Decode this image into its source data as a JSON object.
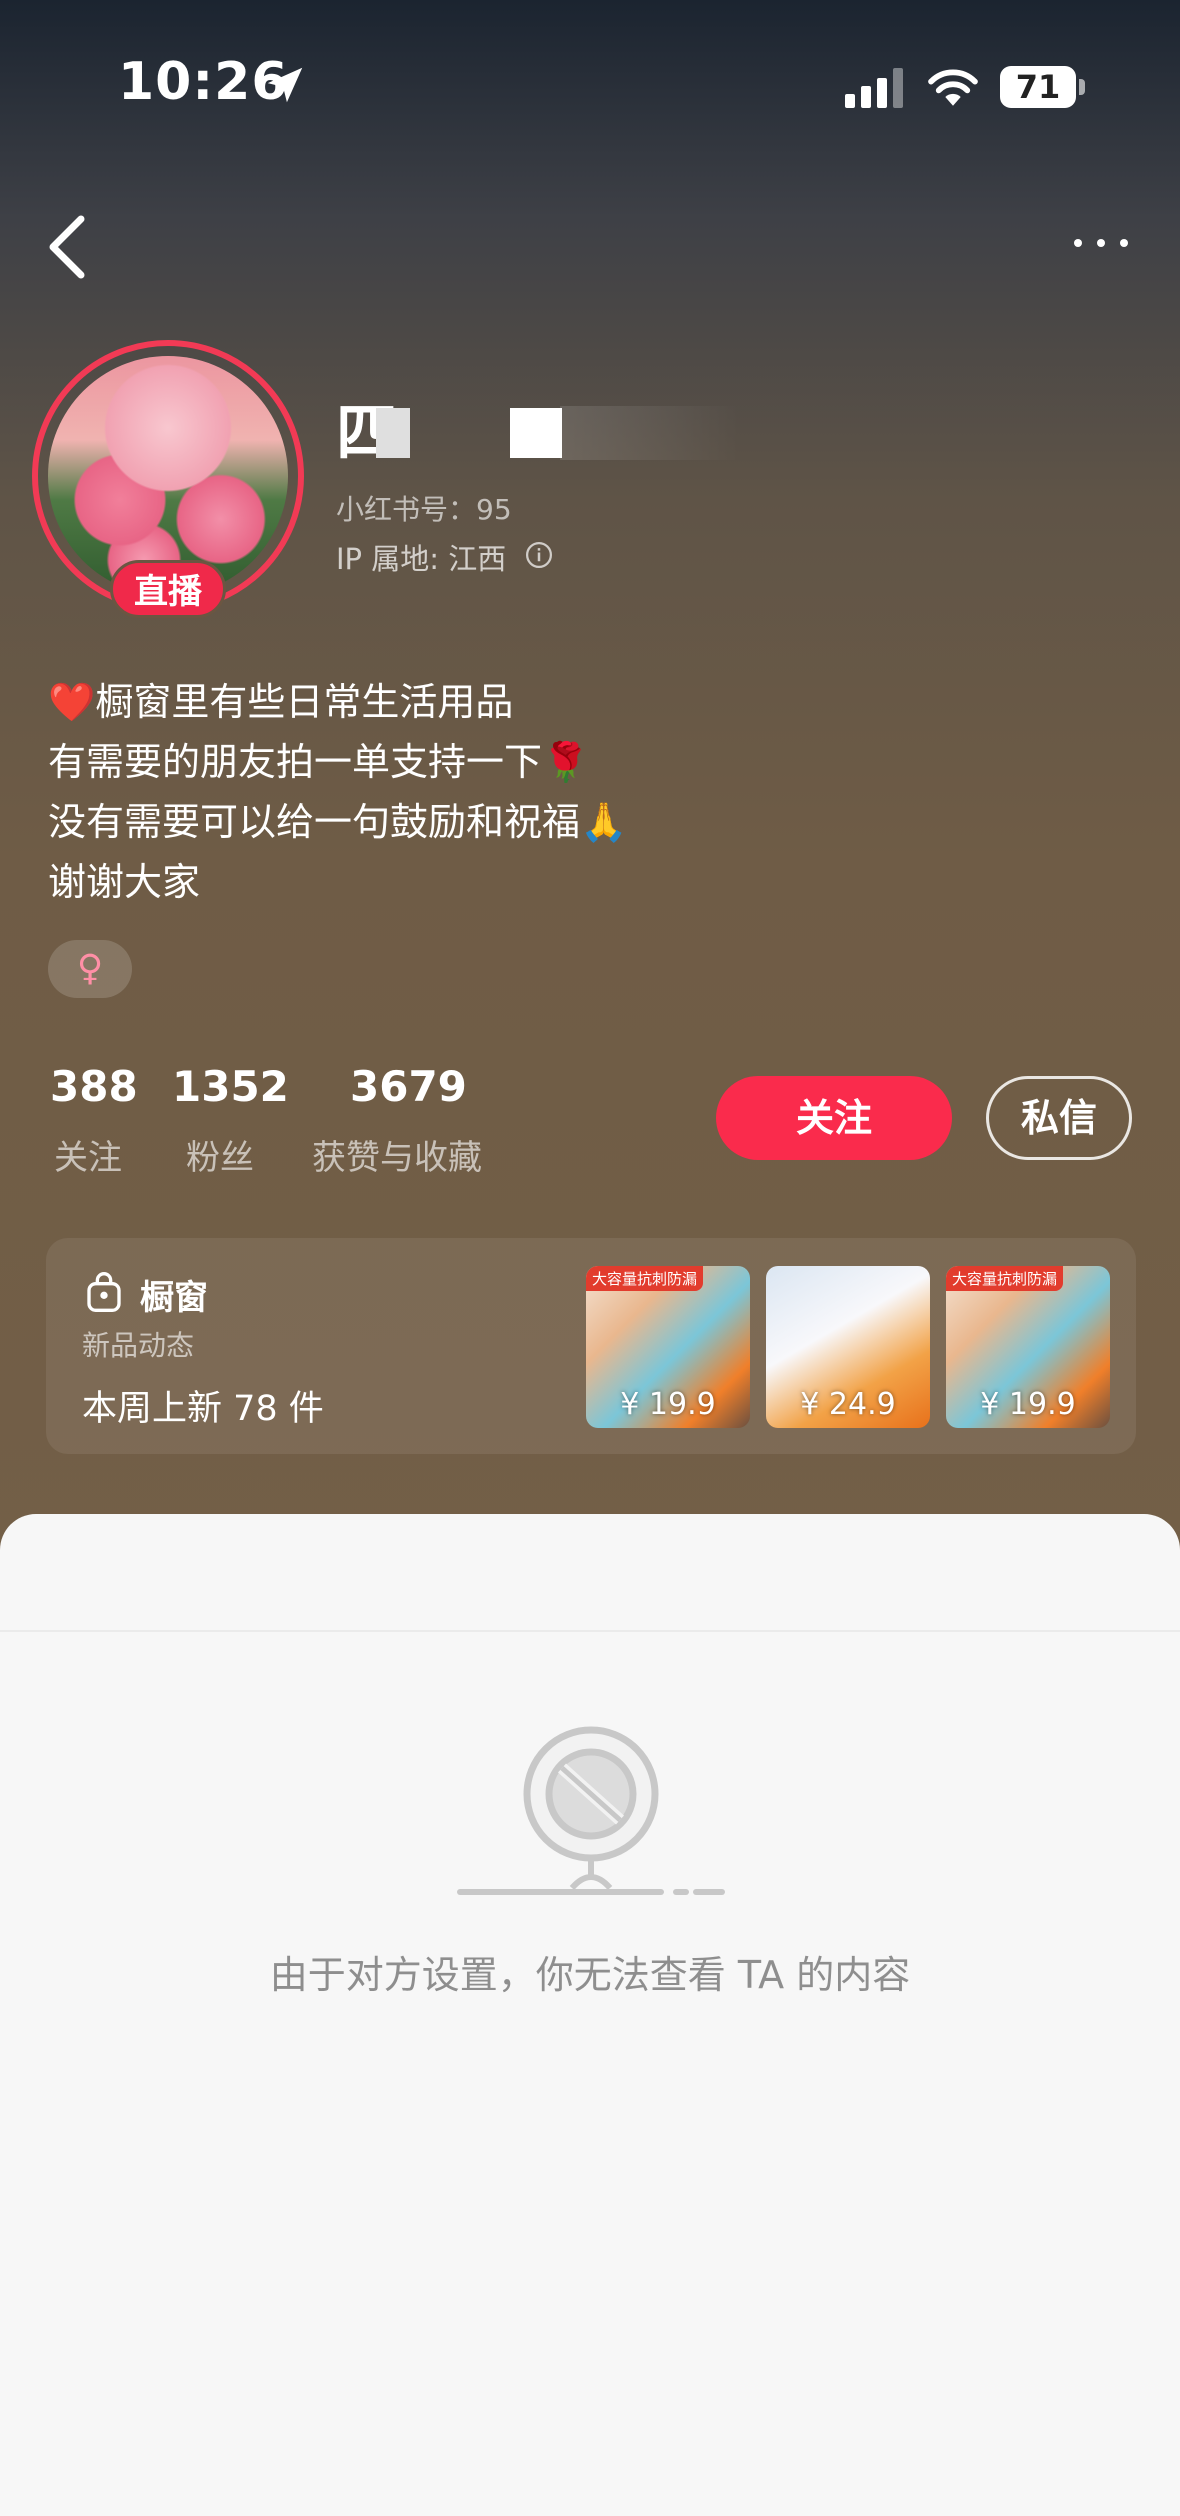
{
  "status_bar": {
    "time": "10:26",
    "battery": "71",
    "icons": [
      "location-arrow-icon",
      "cellular-signal-icon",
      "wifi-icon",
      "battery-icon"
    ]
  },
  "nav": {
    "back_icon": "chevron-left-icon",
    "more_icon": "more-dots-icon"
  },
  "profile": {
    "live_badge": "直播",
    "username_visible": "四",
    "redbook_id": "小红书号：95",
    "ip_location": "IP 属地: 江西",
    "bio": [
      "❤️橱窗里有些日常生活用品",
      "有需要的朋友拍一单支持一下🌹",
      "没有需要可以给一句鼓励和祝福🙏",
      "谢谢大家"
    ],
    "gender_symbol": "♀"
  },
  "stats": [
    {
      "value": "388",
      "label": "关注"
    },
    {
      "value": "1352",
      "label": "粉丝"
    },
    {
      "value": "3679",
      "label": "获赞与收藏"
    }
  ],
  "actions": {
    "follow": "关注",
    "message": "私信"
  },
  "shop": {
    "title": "橱窗",
    "subtitle": "新品动态",
    "weekly": "本周上新 78 件",
    "products": [
      {
        "tag": "大容量抗刺防漏",
        "price": "¥ 19.9"
      },
      {
        "tag": "",
        "price": "¥ 24.9"
      },
      {
        "tag": "大容量抗刺防漏",
        "price": "¥ 19.9"
      }
    ]
  },
  "content": {
    "blocked_message": "由于对方设置，你无法查看 TA 的内容"
  },
  "colors": {
    "accent": "#fa2b4c",
    "live_ring": "#f23a55"
  }
}
